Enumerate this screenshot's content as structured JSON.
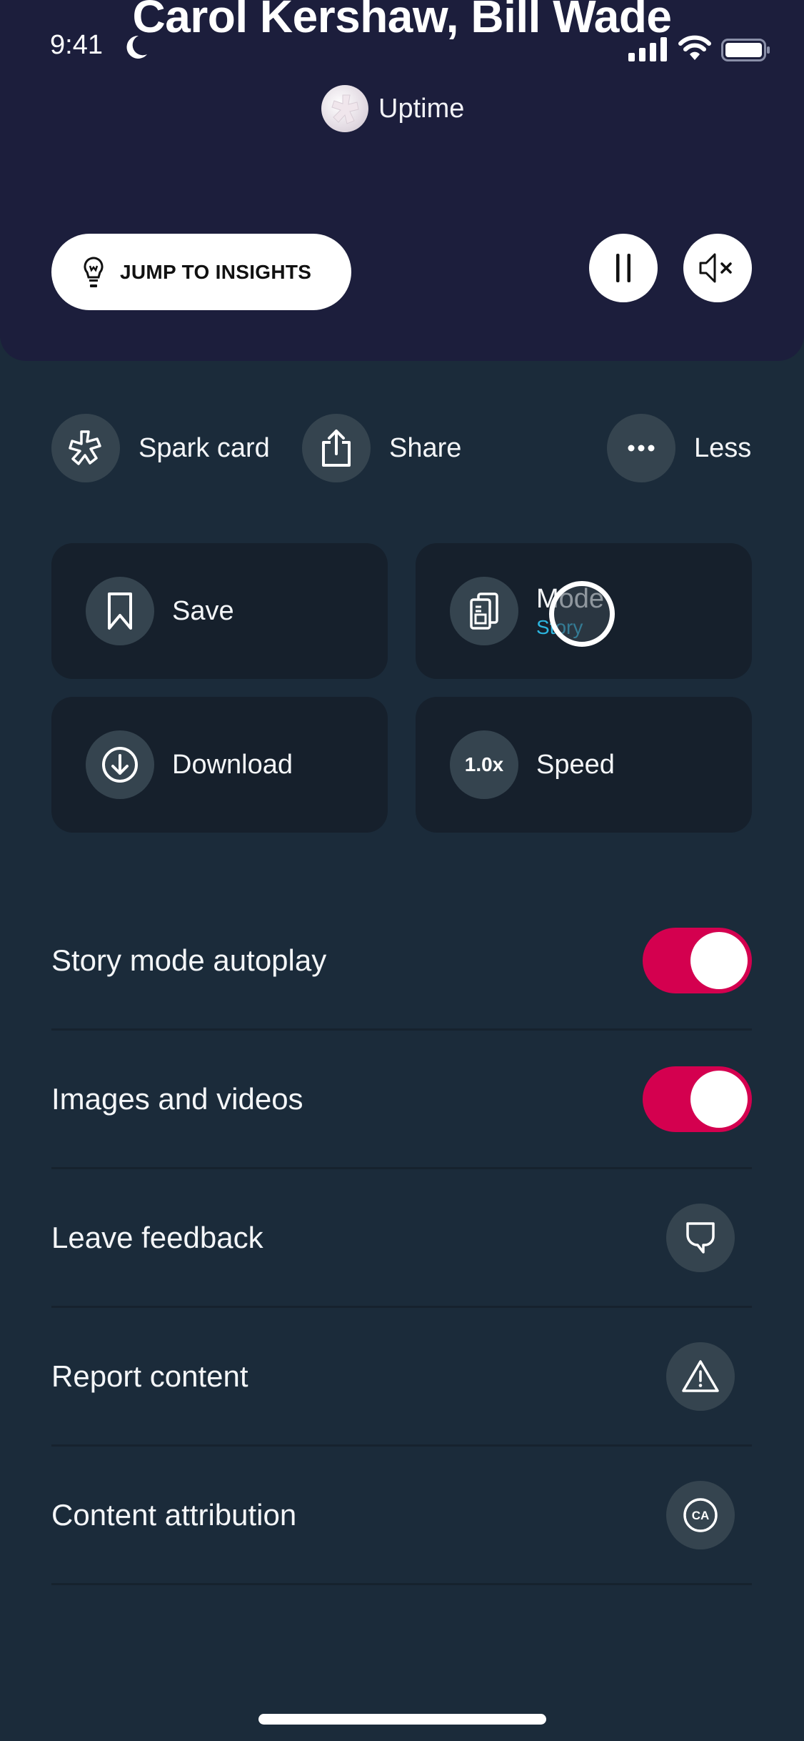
{
  "header": {
    "title": "Carol Kershaw, Bill Wade",
    "brand_name": "Uptime",
    "jump_button_label": "JUMP TO INSIGHTS",
    "pause_icon": "pause-icon",
    "mute_icon": "speaker-muted-icon"
  },
  "status_bar": {
    "time": "9:41",
    "focus_icon": "moon-icon",
    "signal_icon": "cellular-signal-icon",
    "wifi_icon": "wifi-icon",
    "battery_icon": "battery-full-icon"
  },
  "quick_actions": [
    {
      "label": "Spark card",
      "icon": "spark-icon"
    },
    {
      "label": "Share",
      "icon": "share-icon"
    },
    {
      "label": "Less",
      "icon": "more-dots-icon"
    }
  ],
  "cards": {
    "save": {
      "label": "Save",
      "icon": "bookmark-icon"
    },
    "mode": {
      "label": "Mode",
      "value": "Story",
      "icon": "pages-icon"
    },
    "download": {
      "label": "Download",
      "icon": "download-icon"
    },
    "speed": {
      "label": "Speed",
      "value": "1.0x"
    }
  },
  "settings": [
    {
      "label": "Story mode autoplay",
      "type": "toggle",
      "on": true
    },
    {
      "label": "Images and videos",
      "type": "toggle",
      "on": true
    },
    {
      "label": "Leave feedback",
      "type": "button",
      "icon": "chat-bubble-icon"
    },
    {
      "label": "Report content",
      "type": "button",
      "icon": "warning-icon"
    },
    {
      "label": "Content attribution",
      "type": "button",
      "icon": "ca-badge-icon",
      "icon_text": "CA"
    }
  ],
  "colors": {
    "header_bg": "#1c1e3c",
    "body_bg": "#1b2b3a",
    "card_bg": "#16202c",
    "icon_circle_bg": "#35444f",
    "toggle_on": "#d4004f",
    "accent_text": "#2bb6e0"
  }
}
